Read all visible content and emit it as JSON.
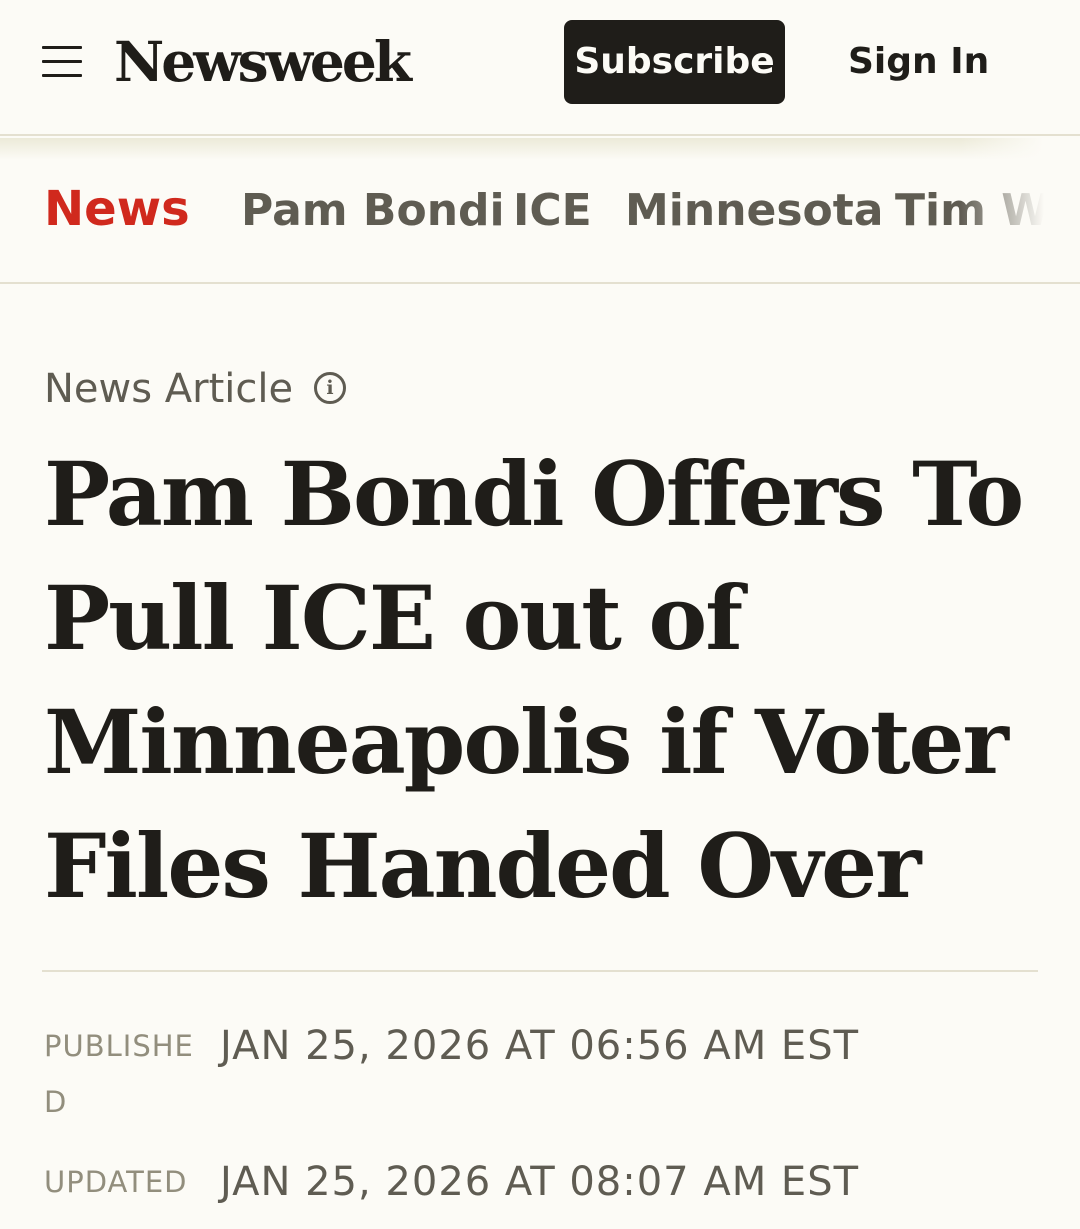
{
  "header": {
    "logo": "Newsweek",
    "subscribe_label": "Subscribe",
    "signin_label": "Sign In"
  },
  "topics": [
    {
      "label": "News",
      "active": true
    },
    {
      "label": "Pam Bondi",
      "active": false
    },
    {
      "label": "ICE",
      "active": false
    },
    {
      "label": "Minnesota",
      "active": false
    },
    {
      "label": "Tim Wa",
      "active": false
    }
  ],
  "article": {
    "type_label": "News Article",
    "info_glyph": "i",
    "headline": "Pam Bondi Offers To Pull ICE out of Minneapolis if Voter Files Handed Over",
    "published_label": "PUBLISHED",
    "published_value": "JAN 25, 2026 AT 06:56 AM EST",
    "updated_label": "UPDATED",
    "updated_value": "JAN 25, 2026 AT 08:07 AM EST"
  },
  "colors": {
    "background": "#fcfbf6",
    "text": "#1f1d19",
    "accent_red": "#d0291d",
    "muted": "#5f5c52",
    "divider": "#e4e0d0"
  }
}
